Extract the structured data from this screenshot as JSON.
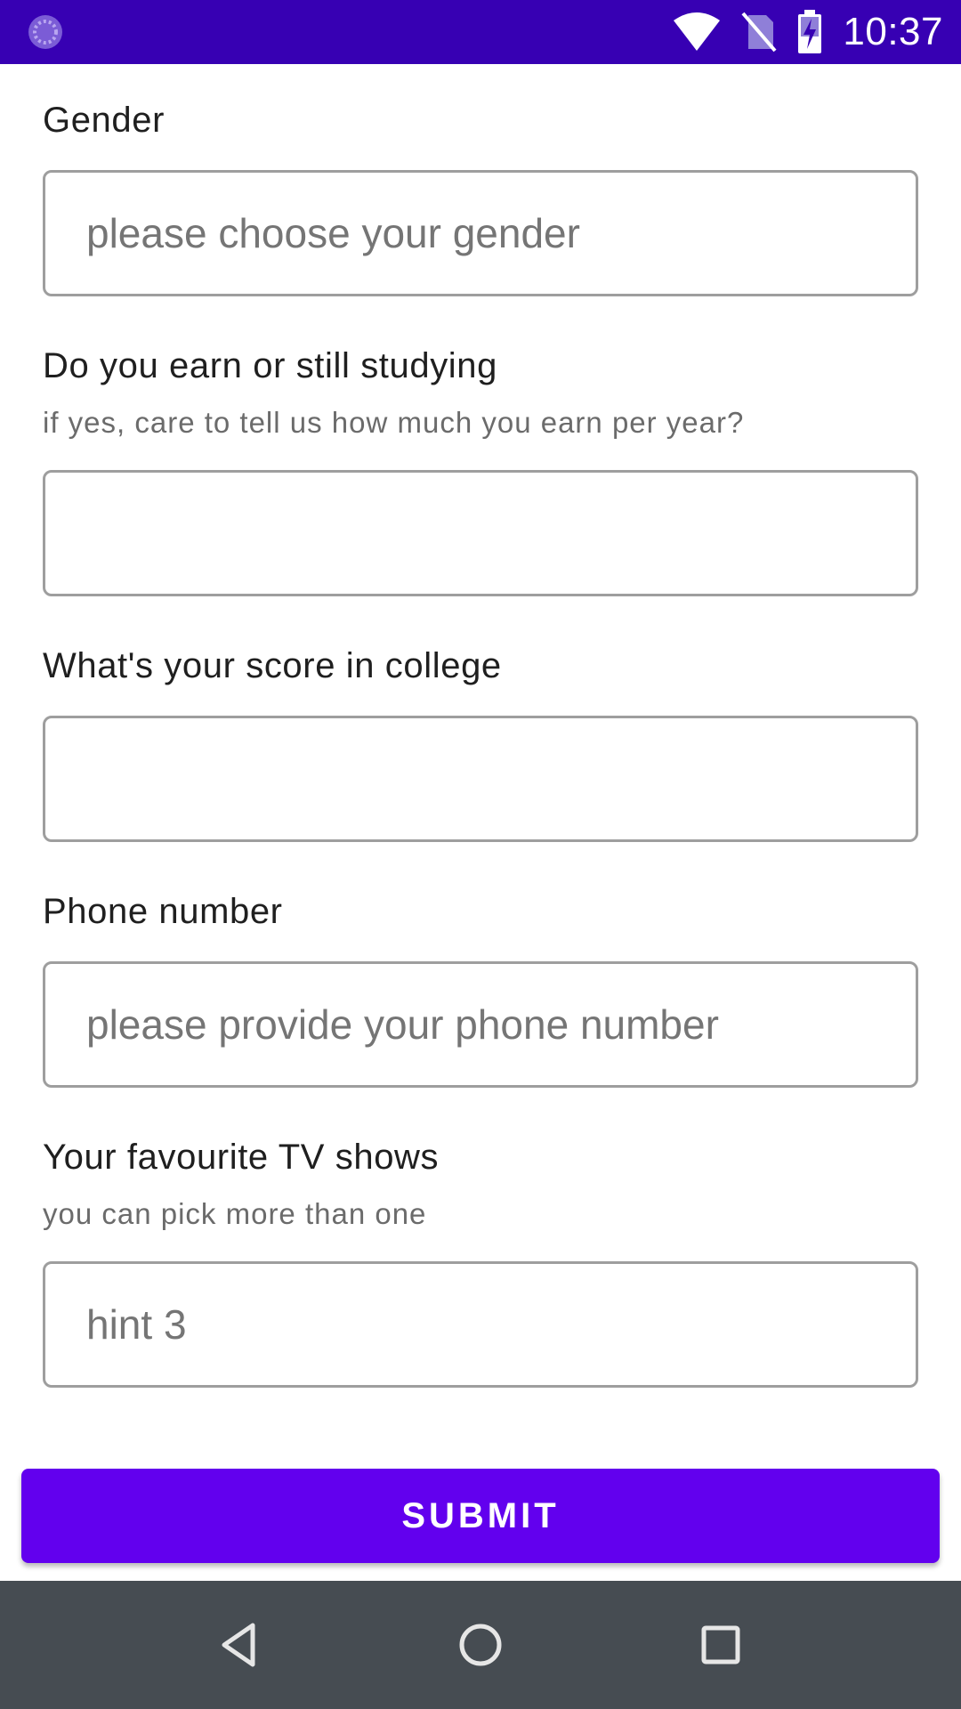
{
  "status_bar": {
    "time": "10:37",
    "icons": [
      "app-notification-icon",
      "wifi-icon",
      "no-sim-icon",
      "battery-charging-icon"
    ]
  },
  "form": {
    "gender": {
      "label": "Gender",
      "placeholder": "please choose your gender",
      "value": ""
    },
    "earn": {
      "label": "Do you earn or still studying",
      "helper": "if yes, care to tell us how much you earn per year?",
      "placeholder": "",
      "value": ""
    },
    "score": {
      "label": "What's  your score in college",
      "placeholder": "",
      "value": ""
    },
    "phone": {
      "label": "Phone number",
      "placeholder": "please provide your phone number",
      "value": ""
    },
    "tv_shows": {
      "label": "Your favourite TV shows",
      "helper": "you can pick more than one",
      "placeholder": "hint 3",
      "value": ""
    },
    "submit_label": "SUBMIT"
  },
  "nav_bar": {
    "icons": [
      "back-icon",
      "home-icon",
      "recents-icon"
    ]
  },
  "colors": {
    "status_bar": "#3700b3",
    "accent": "#6200ee",
    "nav_bar": "#464c52"
  }
}
